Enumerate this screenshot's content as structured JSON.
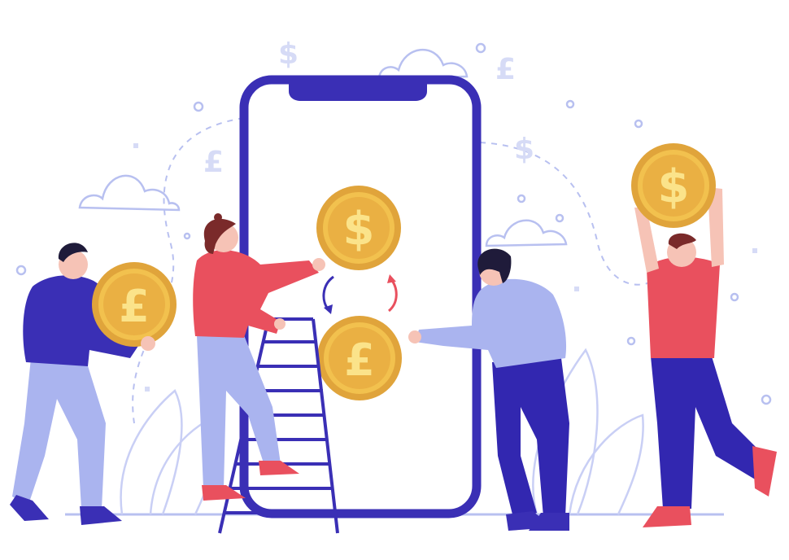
{
  "scene": {
    "description_type": "illustration",
    "colors": {
      "phone_frame": "#3a2fb5",
      "coin_gold": "#f2c14e",
      "coin_edge": "#e0a43b",
      "coin_symbol": "#fbe38a",
      "accent_red": "#e9505e",
      "navy": "#3227b0",
      "lavender": "#aab4ef",
      "skin": "#f6c3b6",
      "hair": "#1f1b3a",
      "decor_blue": "#b8c0f0"
    },
    "coins": [
      {
        "symbol": "$",
        "icon": "dollar-coin-icon"
      },
      {
        "symbol": "£",
        "icon": "pound-coin-icon"
      },
      {
        "symbol": "£",
        "icon": "pound-coin-icon"
      },
      {
        "symbol": "$",
        "icon": "dollar-coin-icon"
      }
    ],
    "floating_symbols": [
      "$",
      "£",
      "£",
      "$"
    ]
  }
}
